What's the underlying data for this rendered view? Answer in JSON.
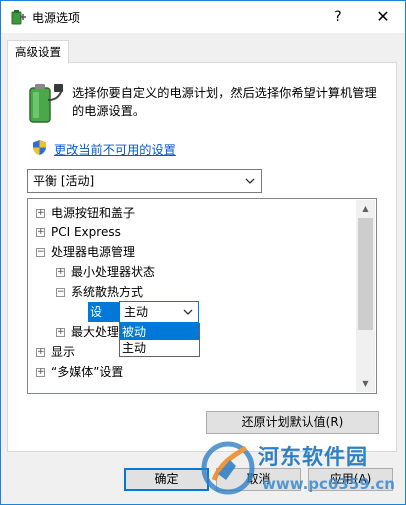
{
  "window": {
    "title": "电源选项",
    "help_glyph": "?",
    "close_glyph": "✕",
    "app_icon": "power-options-icon"
  },
  "tab": {
    "label": "高级设置"
  },
  "intro": {
    "text": "选择你要自定义的电源计划，然后选择你希望计算机管理的电源设置。",
    "icon": "battery-plug-icon"
  },
  "change_link": {
    "text": "更改当前不可用的设置",
    "icon": "uac-shield-icon"
  },
  "plan_select": {
    "value": "平衡 [活动]"
  },
  "tree": {
    "items": [
      {
        "label": "电源按钮和盖子",
        "expander": "+"
      },
      {
        "label": "PCI Express",
        "expander": "+"
      },
      {
        "label": "处理器电源管理",
        "expander": "−"
      },
      {
        "label": "最小处理器状态",
        "expander": "+"
      },
      {
        "label": "系统散热方式",
        "expander": "−"
      },
      {
        "label": "最大处理",
        "expander": "+"
      },
      {
        "label": "显示",
        "expander": "+"
      },
      {
        "label": "“多媒体”设置",
        "expander": "+"
      }
    ],
    "setting_label": "设置：",
    "combo_value": "主动",
    "dropdown_options": [
      "被动",
      "主动"
    ],
    "selected_option": "被动"
  },
  "buttons": {
    "restore": "还原计划默认值(R)",
    "ok": "确定",
    "cancel": "取消",
    "apply": "应用(A)"
  },
  "watermark": {
    "name": "河东软件园",
    "url": "www.pc0359.cn"
  },
  "colors": {
    "accent": "#0078d7",
    "link": "#0a58c8",
    "watermark": "#2f7fc3"
  }
}
